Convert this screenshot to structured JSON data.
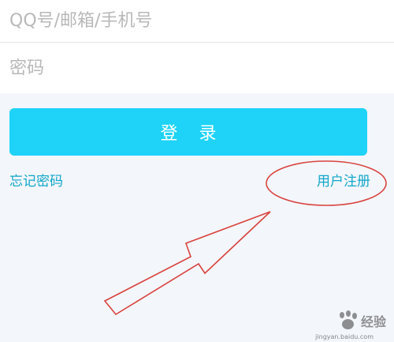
{
  "login": {
    "account_placeholder": "QQ号/邮箱/手机号",
    "password_placeholder": "密码",
    "login_button": "登 录",
    "forgot_password": "忘记密码",
    "register": "用户注册"
  },
  "watermark": {
    "text": "经验",
    "url": "jingyan.baidu.com"
  },
  "colors": {
    "accent": "#1ed3f7",
    "link": "#12a7c9",
    "annotation": "#d9433f",
    "background": "#f3f6fb"
  }
}
